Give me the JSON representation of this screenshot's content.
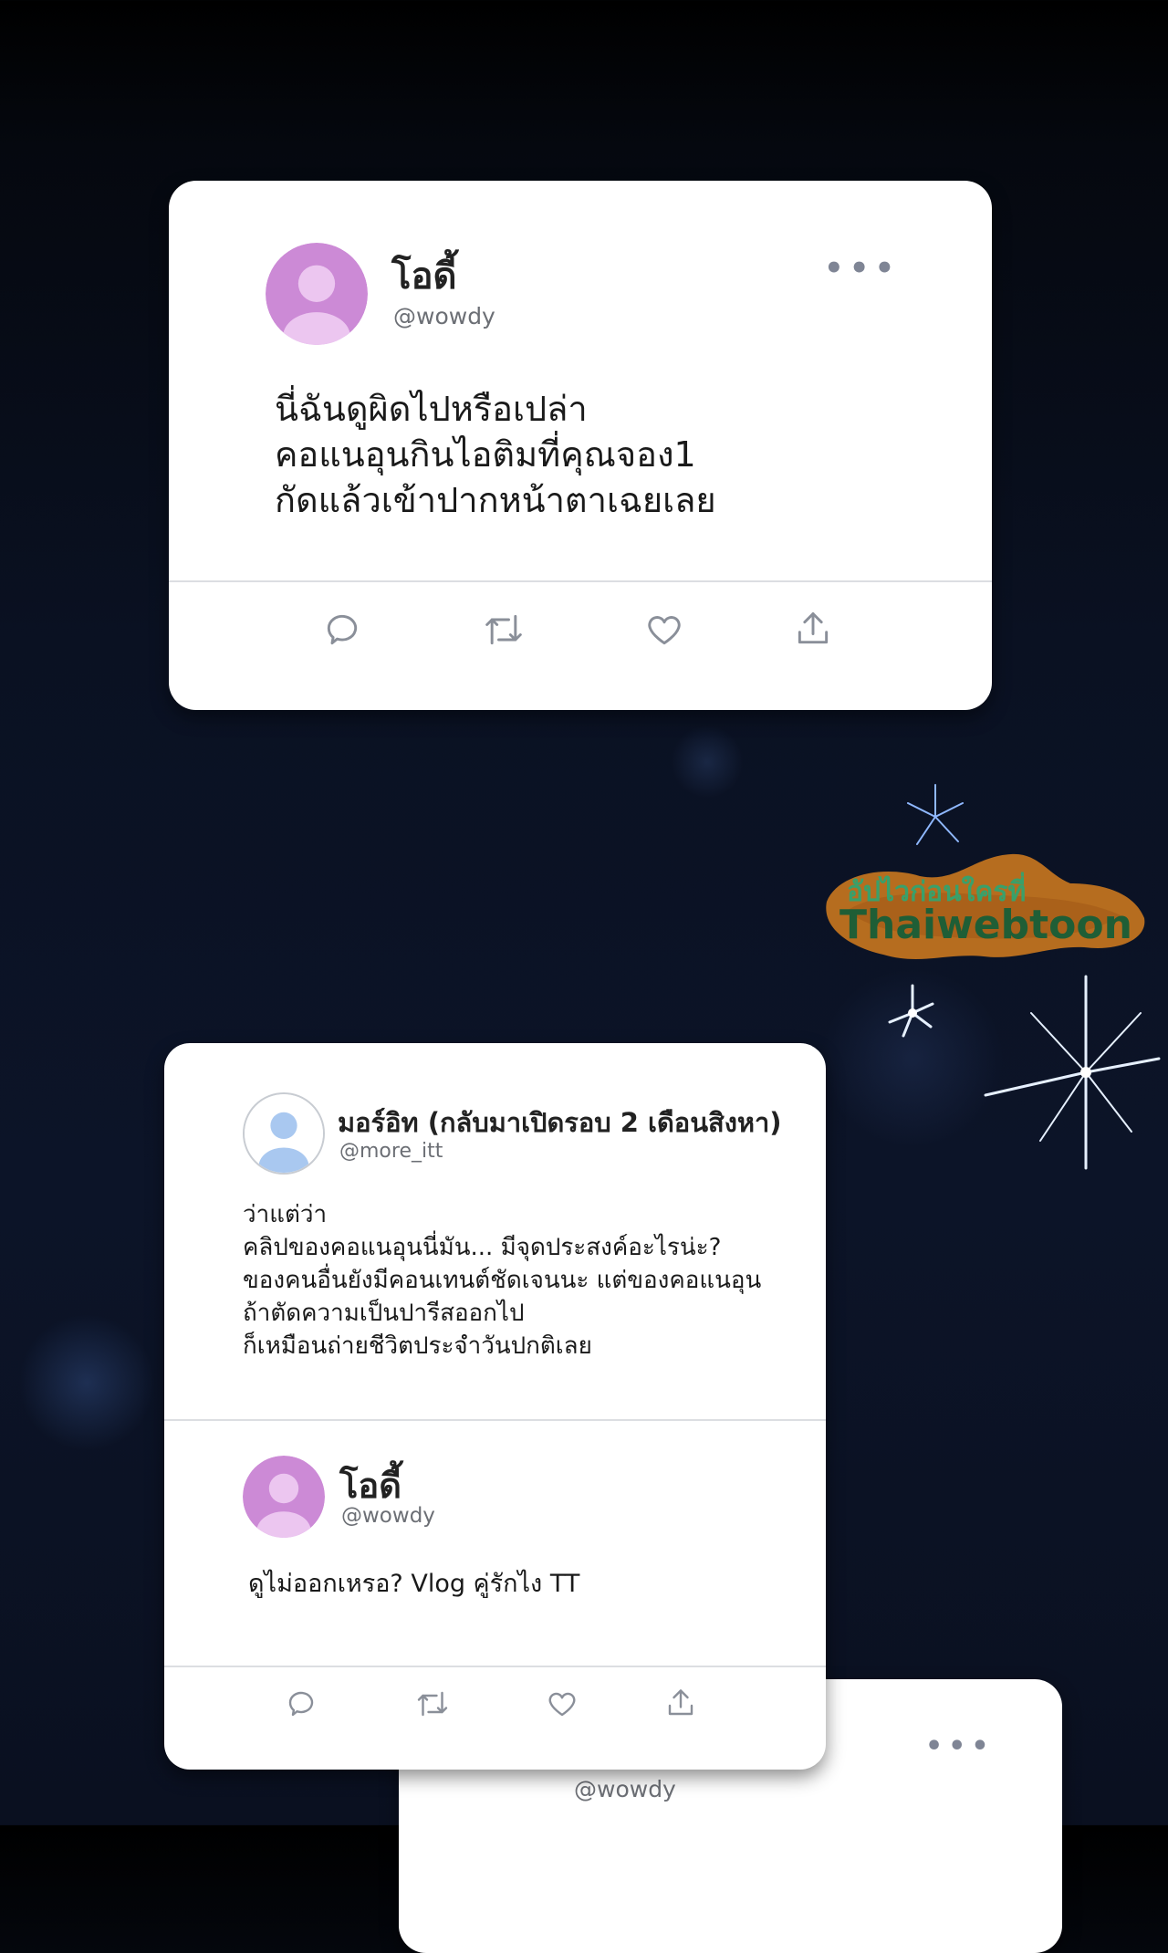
{
  "post1": {
    "author_name": "โอดี้",
    "author_handle": "@wowdy",
    "more_icon": "more-horizontal-icon",
    "lines": [
      "นี่ฉันดูผิดไปหรือเปล่า",
      "คอแนอุนกินไอติมที่คุณจอง1",
      "กัดแล้วเข้าปากหน้าตาเฉยเลย"
    ],
    "actions": [
      "reply-icon",
      "retweet-icon",
      "like-icon",
      "share-icon"
    ]
  },
  "watermark": {
    "line1": "อัปไวก่อนใครที่",
    "line2": "Thaiwebtoon"
  },
  "post2": {
    "author_name": "มอร์อิท (กลับมาเปิดรอบ 2 เดือนสิงหา)",
    "author_handle": "@more_itt",
    "lines": [
      "ว่าแต่ว่า",
      "คลิปของคอแนอุนนี่มัน... มีจุดประสงค์อะไรน่ะ?",
      "ของคนอื่นยังมีคอนเทนต์ชัดเจนนะ แต่ของคอแนอุน",
      "ถ้าตัดความเป็นปารีสออกไป",
      "ก็เหมือนถ่ายชีวิตประจำวันปกติเลย"
    ],
    "reply": {
      "author_name": "โอดี้",
      "author_handle": "@wowdy",
      "text": "ดูไม่ออกเหรอ? Vlog คู่รักไง TT"
    },
    "actions": [
      "reply-icon",
      "retweet-icon",
      "like-icon",
      "share-icon"
    ]
  },
  "post3": {
    "author_handle": "@wowdy",
    "more_icon": "more-horizontal-icon"
  },
  "colors": {
    "avatar_purple": "#cc8ad6",
    "avatar_blue": "#a9c8f0",
    "icon_gray": "#8a8f99"
  }
}
